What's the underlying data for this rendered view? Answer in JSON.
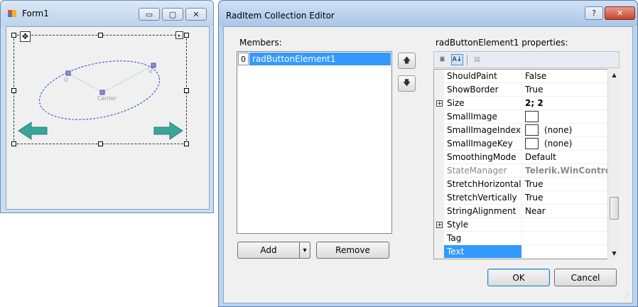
{
  "form1": {
    "title": "Form1",
    "minimize_glyph": "▭",
    "maximize_glyph": "▢",
    "close_glyph": "✕",
    "designer": {
      "label_u": "U",
      "label_v": "V",
      "label_center": "Center",
      "move_glyph": "✥",
      "smart_tag_glyph": "▸",
      "arrow_color": "#3aa59a"
    }
  },
  "dialog": {
    "title": "RadItem Collection Editor",
    "help_glyph": "?",
    "close_glyph": "✕",
    "members_label": "Members:",
    "members": [
      {
        "index": "0",
        "name": "radButtonElement1"
      }
    ],
    "move_up_glyph": "🡅",
    "move_down_glyph": "🡇",
    "add_label": "Add",
    "add_dropdown_glyph": "▾",
    "remove_label": "Remove",
    "properties_label": "radButtonElement1 properties:",
    "toolbar": {
      "categorized_glyph": "≣",
      "alphabetical_glyph": "A↓",
      "property_pages_glyph": "▤"
    },
    "properties": [
      {
        "name": "ShouldPaint",
        "value": "False"
      },
      {
        "name": "ShowBorder",
        "value": "True"
      },
      {
        "name": "Size",
        "value": "2; 2",
        "expandable": true,
        "bold": true
      },
      {
        "name": "SmallImage",
        "value": "",
        "swatch": true
      },
      {
        "name": "SmallImageIndex",
        "value": "(none)",
        "swatch": true
      },
      {
        "name": "SmallImageKey",
        "value": "(none)",
        "swatch": true
      },
      {
        "name": "SmoothingMode",
        "value": "Default"
      },
      {
        "name": "StateManager",
        "value": "Telerik.WinControls.S",
        "disabled": true
      },
      {
        "name": "StretchHorizontally",
        "value": "True"
      },
      {
        "name": "StretchVertically",
        "value": "True"
      },
      {
        "name": "StringAlignment",
        "value": "Near"
      },
      {
        "name": "Style",
        "value": "",
        "expandable": true
      },
      {
        "name": "Tag",
        "value": ""
      },
      {
        "name": "Text",
        "value": "",
        "selected": true,
        "dropdown": true
      }
    ],
    "expand_glyph": "+",
    "dropdown_glyph": "▼",
    "scroll_up_glyph": "▲",
    "scroll_down_glyph": "▼",
    "ok_label": "OK",
    "cancel_label": "Cancel",
    "grip_glyph": "⋰"
  }
}
